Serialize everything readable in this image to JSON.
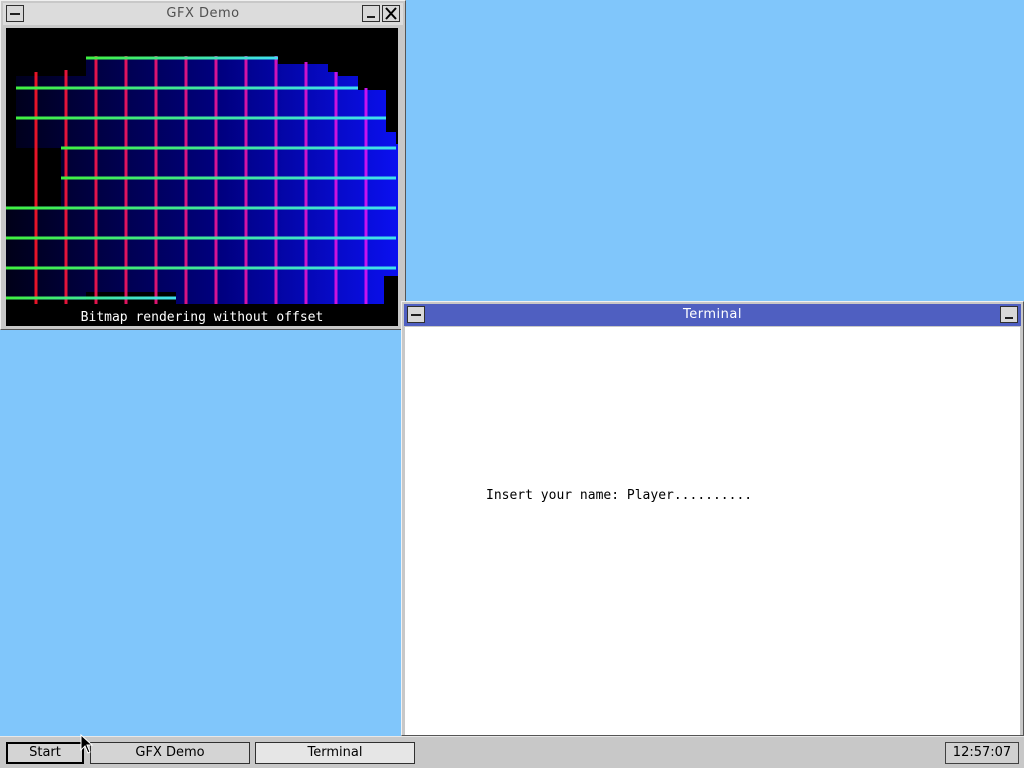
{
  "gfx_window": {
    "title": "GFX Demo",
    "caption": "Bitmap rendering without offset"
  },
  "terminal_window": {
    "title": "Terminal",
    "prompt": "Insert your name: ",
    "input_value": "Player.........."
  },
  "taskbar": {
    "start_label": "Start",
    "tasks": [
      "GFX Demo",
      "Terminal"
    ],
    "clock": "12:57:07"
  },
  "colors": {
    "desktop": "#80c6fb",
    "active_titlebar": "#4f5fc1",
    "inactive_titlebar": "#dcdcdc",
    "window_face": "#c8c8c8"
  }
}
